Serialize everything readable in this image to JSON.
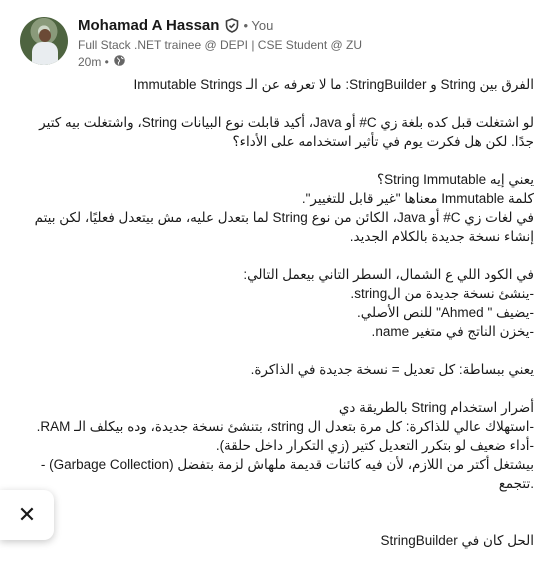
{
  "author": {
    "name": "Mohamad A Hassan",
    "you_label": "• You",
    "headline": "Full Stack .NET trainee @ DEPI | CSE Student @ ZU",
    "time": "20m •"
  },
  "post": {
    "lines": [
      "الفرق بين String و StringBuilder: ما لا تعرفه عن الـ Immutable Strings",
      "",
      "لو اشتغلت قبل كده بلغة زي C# أو Java، أكيد قابلت نوع البيانات String، واشتغلت بيه كتير جدًا. لكن هل فكرت يوم في تأثير استخدامه على الأداء؟",
      "",
      "يعني إيه String Immutable؟",
      "كلمة Immutable معناها \"غير قابل للتغيير\".",
      "في لغات زي C# أو Java، الكائن من نوع String لما بتعدل عليه، مش بيتعدل فعليًا، لكن بيتم إنشاء نسخة جديدة بالكلام الجديد.",
      "",
      "في الكود اللي ع الشمال، السطر التاني بيعمل التالي:",
      "-ينشئ نسخة جديدة من الstring.",
      "-يضيف \" Ahmed\" للنص الأصلي.",
      "-يخزن الناتج في متغير name.",
      "",
      "يعني ببساطة: كل تعديل = نسخة جديدة في الذاكرة.",
      "",
      "أضرار استخدام String بالطريقة دي",
      "-استهلاك عالي للذاكرة: كل مرة بتعدل ال string، بتنشئ نسخة جديدة، وده بيكلف الـ RAM.",
      "-أداء ضعيف لو بتكرر التعديل كتير (زي التكرار داخل حلقة).",
      "- (Garbage Collection) بيشتغل أكتر من اللازم، لأن فيه كائنات قديمة ملهاش لزمة بتفضل تتجمع.",
      "",
      "",
      "الحل كان في StringBuilder"
    ]
  },
  "toast": {
    "close_label": "✕"
  }
}
